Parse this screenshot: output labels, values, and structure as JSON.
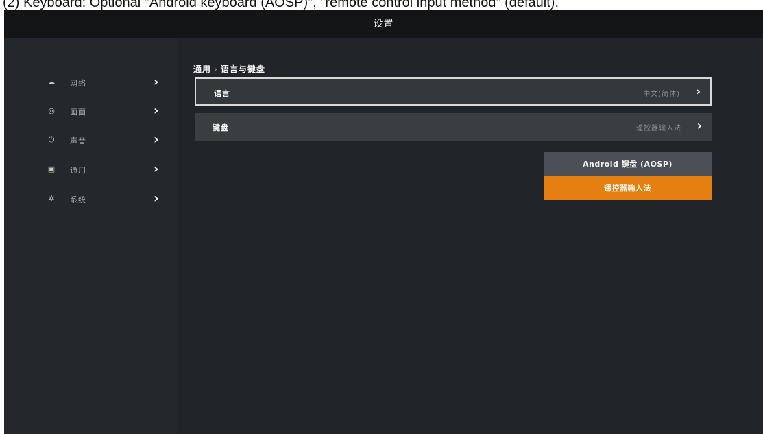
{
  "caption": "(2)    Keyboard: Optional \"Android keyboard (AOSP)\", \"remote control input method\" (default).",
  "header": {
    "title": "设置"
  },
  "sidebar": {
    "items": [
      {
        "icon": "wifi-icon",
        "glyph": "☁",
        "label": "网络"
      },
      {
        "icon": "display-icon",
        "glyph": "◎",
        "label": "画面"
      },
      {
        "icon": "power-icon",
        "glyph": "⏻",
        "label": "声音"
      },
      {
        "icon": "calendar-icon",
        "glyph": "▣",
        "label": "通用"
      },
      {
        "icon": "gear-icon",
        "glyph": "✲",
        "label": "系统"
      }
    ],
    "chevron": "›"
  },
  "main": {
    "breadcrumb": {
      "parent": "通用",
      "separator": "›",
      "current": "语言与键盘"
    },
    "rows": [
      {
        "label": "语言",
        "value": "中文(简体)",
        "chevron": "›"
      },
      {
        "label": "键盘",
        "value": "遥控器输入法",
        "chevron": "›"
      }
    ]
  },
  "dropdown": {
    "options": [
      {
        "label": "Android 键盘 (AOSP)",
        "selected": false
      },
      {
        "label": "遥控器输入法",
        "selected": true
      }
    ]
  },
  "colors": {
    "accent": "#e67f12",
    "background": "#212428",
    "topbar": "#141517",
    "sidebar": "#24272b",
    "row": "#3a3d41"
  }
}
